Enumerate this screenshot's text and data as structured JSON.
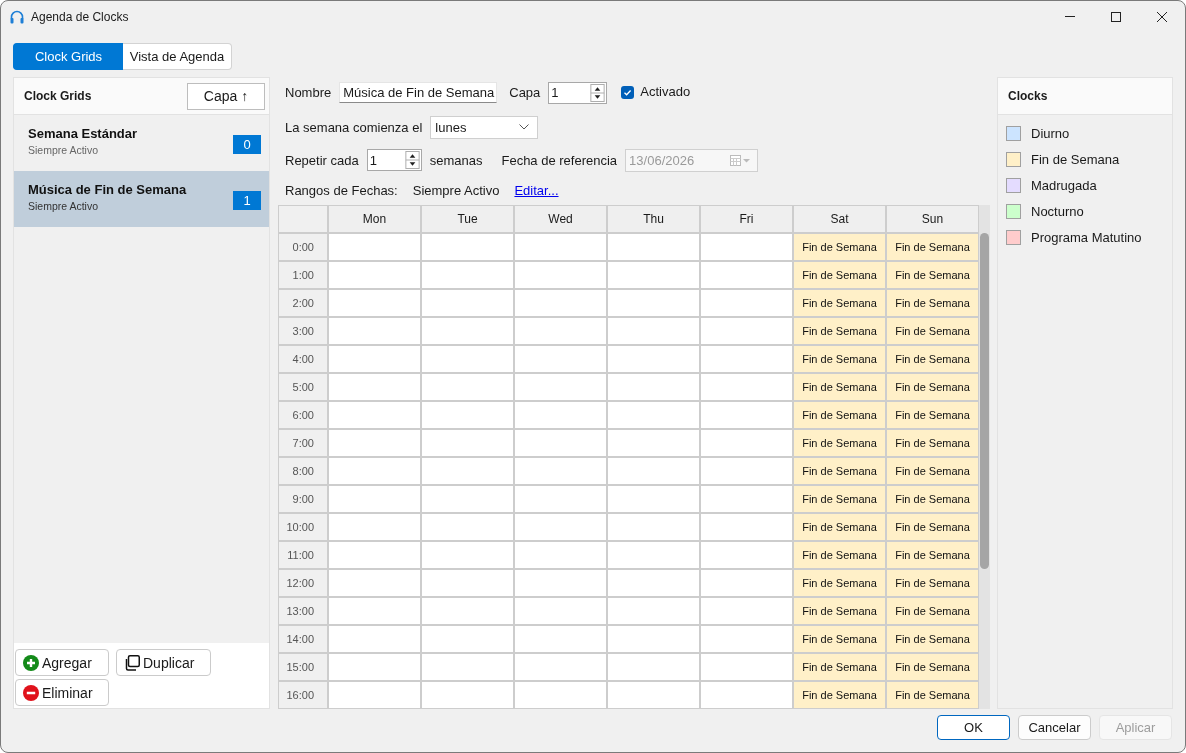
{
  "window": {
    "title": "Agenda de Clocks"
  },
  "tabs": [
    {
      "label": "Clock Grids",
      "selected": true
    },
    {
      "label": "Vista de Agenda",
      "selected": false
    }
  ],
  "clock_grids": {
    "title": "Clock Grids",
    "sort_button": "Capa ↑",
    "items": [
      {
        "name": "Semana Estándar",
        "subtitle": "Siempre Activo",
        "layer": "0",
        "selected": false
      },
      {
        "name": "Música de Fin de Semana",
        "subtitle": "Siempre Activo",
        "layer": "1",
        "selected": true
      }
    ],
    "actions": [
      {
        "kind": "add",
        "label": "Agregar"
      },
      {
        "kind": "duplicate",
        "label": "Duplicar"
      },
      {
        "kind": "delete",
        "label": "Eliminar"
      }
    ]
  },
  "editor": {
    "name": {
      "label": "Nombre",
      "value": "Música de Fin de Semana"
    },
    "layer": {
      "label": "Capa",
      "value": "1"
    },
    "enabled": {
      "label": "Activado",
      "checked": true
    },
    "week_start": {
      "label": "La semana comienza el",
      "value": "lunes"
    },
    "repeat": {
      "label": "Repetir cada",
      "value": "1",
      "unit": "semanas"
    },
    "reference_date": {
      "label": "Fecha de referencia",
      "value": "13/06/2026",
      "disabled": true
    },
    "date_ranges": {
      "label": "Rangos de Fechas:",
      "value": "Siempre Activo",
      "link": "Editar..."
    }
  },
  "grid": {
    "columns": [
      "Mon",
      "Tue",
      "Wed",
      "Thu",
      "Fri",
      "Sat",
      "Sun"
    ],
    "rows": [
      {
        "time": "0:00",
        "cells": [
          null,
          null,
          null,
          null,
          null,
          {
            "clock": "Fin de Semana",
            "color": "#fff0c8"
          },
          {
            "clock": "Fin de Semana",
            "color": "#fff0c8"
          }
        ]
      },
      {
        "time": "1:00",
        "cells": [
          null,
          null,
          null,
          null,
          null,
          {
            "clock": "Fin de Semana",
            "color": "#fff0c8"
          },
          {
            "clock": "Fin de Semana",
            "color": "#fff0c8"
          }
        ]
      },
      {
        "time": "2:00",
        "cells": [
          null,
          null,
          null,
          null,
          null,
          {
            "clock": "Fin de Semana",
            "color": "#fff0c8"
          },
          {
            "clock": "Fin de Semana",
            "color": "#fff0c8"
          }
        ]
      },
      {
        "time": "3:00",
        "cells": [
          null,
          null,
          null,
          null,
          null,
          {
            "clock": "Fin de Semana",
            "color": "#fff0c8"
          },
          {
            "clock": "Fin de Semana",
            "color": "#fff0c8"
          }
        ]
      },
      {
        "time": "4:00",
        "cells": [
          null,
          null,
          null,
          null,
          null,
          {
            "clock": "Fin de Semana",
            "color": "#fff0c8"
          },
          {
            "clock": "Fin de Semana",
            "color": "#fff0c8"
          }
        ]
      },
      {
        "time": "5:00",
        "cells": [
          null,
          null,
          null,
          null,
          null,
          {
            "clock": "Fin de Semana",
            "color": "#fff0c8"
          },
          {
            "clock": "Fin de Semana",
            "color": "#fff0c8"
          }
        ]
      },
      {
        "time": "6:00",
        "cells": [
          null,
          null,
          null,
          null,
          null,
          {
            "clock": "Fin de Semana",
            "color": "#fff0c8"
          },
          {
            "clock": "Fin de Semana",
            "color": "#fff0c8"
          }
        ]
      },
      {
        "time": "7:00",
        "cells": [
          null,
          null,
          null,
          null,
          null,
          {
            "clock": "Fin de Semana",
            "color": "#fff0c8"
          },
          {
            "clock": "Fin de Semana",
            "color": "#fff0c8"
          }
        ]
      },
      {
        "time": "8:00",
        "cells": [
          null,
          null,
          null,
          null,
          null,
          {
            "clock": "Fin de Semana",
            "color": "#fff0c8"
          },
          {
            "clock": "Fin de Semana",
            "color": "#fff0c8"
          }
        ]
      },
      {
        "time": "9:00",
        "cells": [
          null,
          null,
          null,
          null,
          null,
          {
            "clock": "Fin de Semana",
            "color": "#fff0c8"
          },
          {
            "clock": "Fin de Semana",
            "color": "#fff0c8"
          }
        ]
      },
      {
        "time": "10:00",
        "cells": [
          null,
          null,
          null,
          null,
          null,
          {
            "clock": "Fin de Semana",
            "color": "#fff0c8"
          },
          {
            "clock": "Fin de Semana",
            "color": "#fff0c8"
          }
        ]
      },
      {
        "time": "11:00",
        "cells": [
          null,
          null,
          null,
          null,
          null,
          {
            "clock": "Fin de Semana",
            "color": "#fff0c8"
          },
          {
            "clock": "Fin de Semana",
            "color": "#fff0c8"
          }
        ]
      },
      {
        "time": "12:00",
        "cells": [
          null,
          null,
          null,
          null,
          null,
          {
            "clock": "Fin de Semana",
            "color": "#fff0c8"
          },
          {
            "clock": "Fin de Semana",
            "color": "#fff0c8"
          }
        ]
      },
      {
        "time": "13:00",
        "cells": [
          null,
          null,
          null,
          null,
          null,
          {
            "clock": "Fin de Semana",
            "color": "#fff0c8"
          },
          {
            "clock": "Fin de Semana",
            "color": "#fff0c8"
          }
        ]
      },
      {
        "time": "14:00",
        "cells": [
          null,
          null,
          null,
          null,
          null,
          {
            "clock": "Fin de Semana",
            "color": "#fff0c8"
          },
          {
            "clock": "Fin de Semana",
            "color": "#fff0c8"
          }
        ]
      },
      {
        "time": "15:00",
        "cells": [
          null,
          null,
          null,
          null,
          null,
          {
            "clock": "Fin de Semana",
            "color": "#fff0c8"
          },
          {
            "clock": "Fin de Semana",
            "color": "#fff0c8"
          }
        ]
      },
      {
        "time": "16:00",
        "cells": [
          null,
          null,
          null,
          null,
          null,
          {
            "clock": "Fin de Semana",
            "color": "#fff0c8"
          },
          {
            "clock": "Fin de Semana",
            "color": "#fff0c8"
          }
        ]
      }
    ]
  },
  "clocks": {
    "title": "Clocks",
    "items": [
      {
        "name": "Diurno",
        "color": "#cce4ff"
      },
      {
        "name": "Fin de Semana",
        "color": "#fff0c8"
      },
      {
        "name": "Madrugada",
        "color": "#e4dcff"
      },
      {
        "name": "Nocturno",
        "color": "#ccffcc"
      },
      {
        "name": "Programa Matutino",
        "color": "#ffcccc"
      }
    ]
  },
  "buttons": [
    {
      "label": "OK",
      "default": true,
      "disabled": false
    },
    {
      "label": "Cancelar",
      "default": false,
      "disabled": false
    },
    {
      "label": "Aplicar",
      "default": false,
      "disabled": true
    }
  ]
}
